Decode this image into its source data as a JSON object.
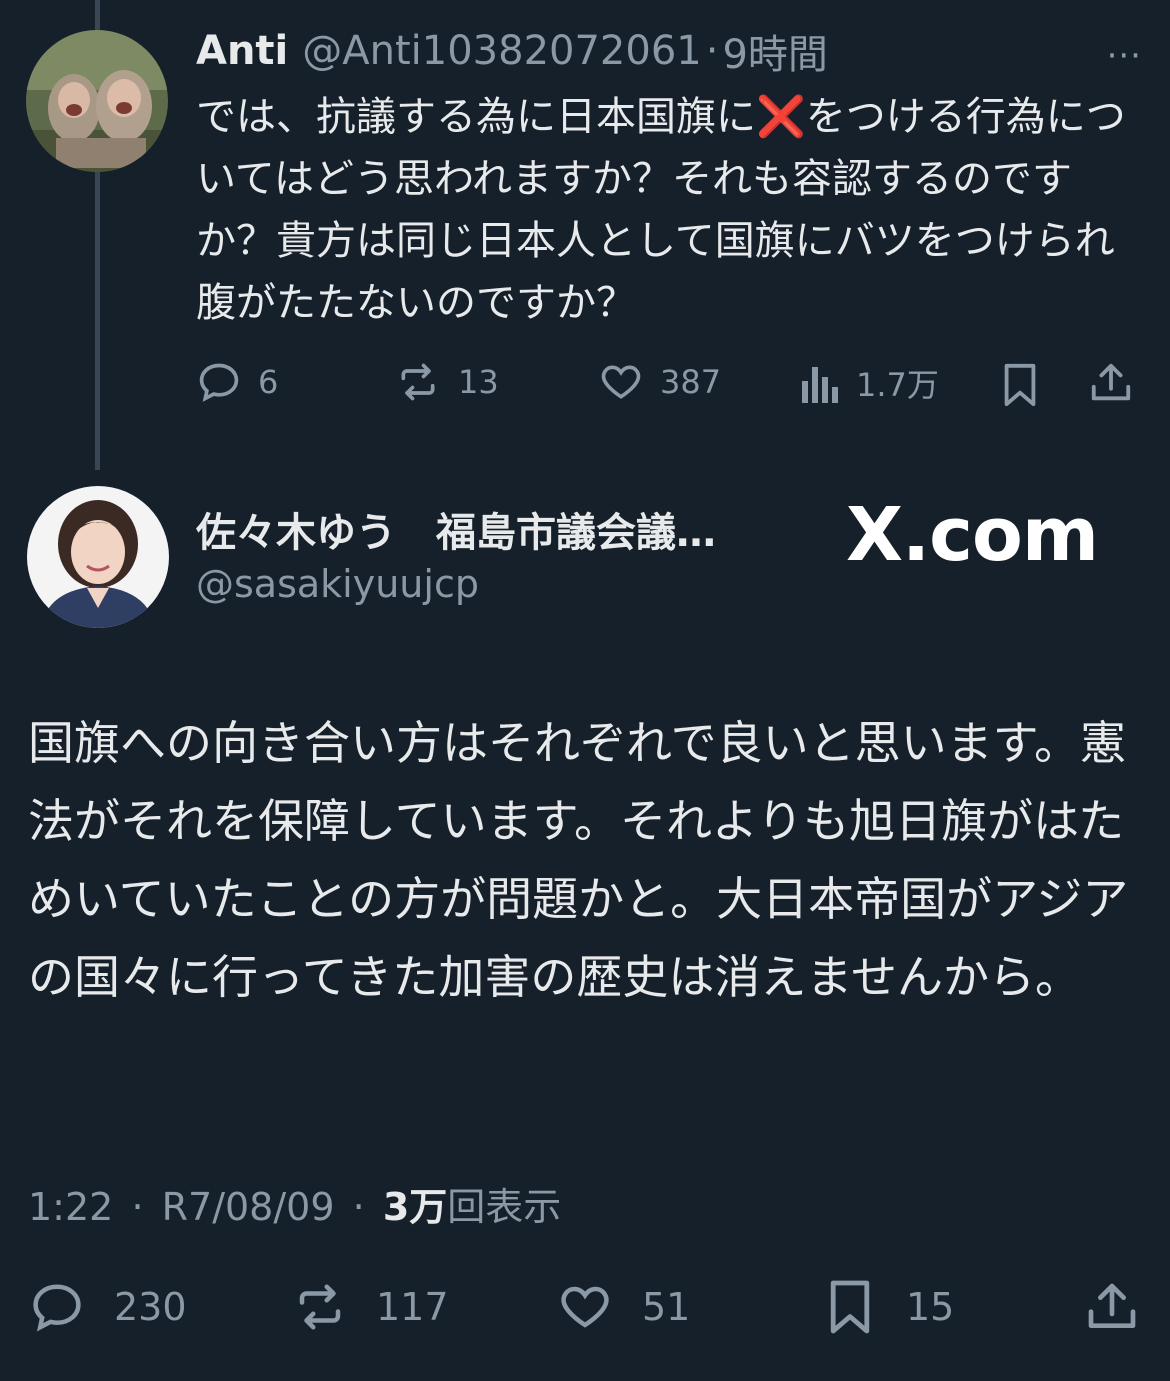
{
  "reply": {
    "name": "Anti",
    "handle": "@Anti10382072061",
    "sep": "·",
    "time": "9時間",
    "more": "···",
    "text_before": "では、抗議する為に日本国旗に",
    "x_emoji": "❌",
    "text_after": "をつける行為についてはどう思われますか？それも容認するのですか？貴方は同じ日本人として国旗にバツをつけられ腹がたたないのですか？",
    "stats": {
      "replies": "6",
      "reposts": "13",
      "likes": "387",
      "views": "1.7万"
    }
  },
  "main": {
    "name": "佐々木ゆう　福島市議会議…",
    "handle": "@sasakiyuujcp",
    "watermark": "X.com",
    "text": "国旗への向き合い方はそれぞれで良いと思います。憲法がそれを保障しています。それよりも旭日旗がはためいていたことの方が問題かと。大日本帝国がアジアの国々に行ってきた加害の歴史は消えませんから。",
    "time": "1:22",
    "sep": "·",
    "date": "R7/08/09",
    "views_count": "3万",
    "views_label": "回表示",
    "stats": {
      "replies": "230",
      "reposts": "117",
      "likes": "51",
      "bookmarks": "15"
    }
  },
  "colors": {
    "background": "#15202b",
    "text": "#e7e9ea",
    "muted": "#8b98a5",
    "thread_line": "#3a4653",
    "x_mark": "#e6232f"
  }
}
